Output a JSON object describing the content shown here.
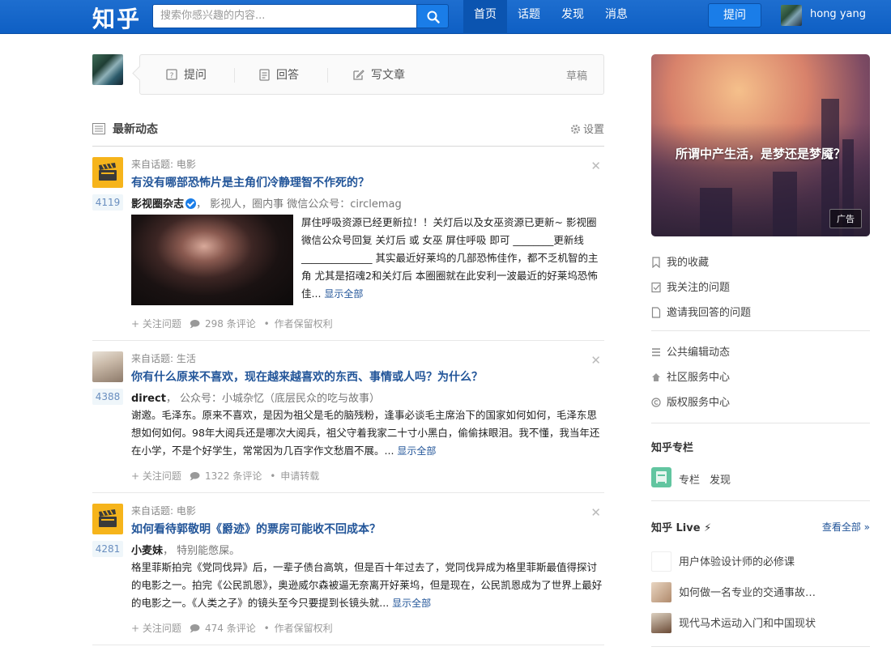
{
  "topbar": {
    "logo": "知乎",
    "search_placeholder": "搜索你感兴趣的内容...",
    "nav": [
      "首页",
      "话题",
      "发现",
      "消息"
    ],
    "ask_label": "提问",
    "user_name": "hong yang"
  },
  "composer": {
    "ask": "提问",
    "answer": "回答",
    "write": "写文章",
    "draft": "草稿"
  },
  "feed": {
    "title": "最新动态",
    "settings": "设置",
    "items": [
      {
        "source": "来自话题: 电影",
        "question": "有没有哪部恐怖片是主角们冷静理智不作死的？",
        "votes": "4119",
        "author": "影视圈杂志",
        "bio": "，  影视人，圈内事 微信公众号：circlemag",
        "excerpt": "屏住呼吸资源已经更新拉！！关灯后以及女巫资源已更新~ 影视圈微信公众号回复 关灯后 或 女巫 屏住呼吸 即可 ________更新线______________ 其实最近好莱坞的几部恐怖佳作，都不乏机智的主角 尤其是招魂2和关灯后 本圈圈就在此安利一波最近的好莱坞恐怖佳...",
        "more": "显示全部",
        "follow": "+ 关注问题",
        "comments": "298 条评论",
        "rights": "作者保留权利"
      },
      {
        "source": "来自话题: 生活",
        "question": "你有什么原来不喜欢，现在越来越喜欢的东西、事情或人吗？为什么？",
        "votes": "4388",
        "author": "direct",
        "bio": "，  公众号：小城杂忆（底层民众的吃与故事）",
        "excerpt": "谢邀。毛泽东。原来不喜欢，是因为祖父是毛的脑残粉，逢事必谈毛主席治下的国家如何如何，毛泽东思想如何如何。98年大阅兵还是哪次大阅兵，祖父守着我家二十寸小黑白，偷偷抹眼泪。我不懂，我当年还在小学，不是个好学生，常常因为几百字作文愁眉不展。...",
        "more": "显示全部",
        "follow": "+ 关注问题",
        "comments": "1322 条评论",
        "rights": "申请转载"
      },
      {
        "source": "来自话题: 电影",
        "question": "如何看待郭敬明《爵迹》的票房可能收不回成本？",
        "votes": "4281",
        "author": "小麦妹",
        "bio": "，  特别能憋屎。",
        "excerpt": "格里菲斯拍完《党同伐异》后，一辈子债台高筑，但是百十年过去了，党同伐异成为格里菲斯最值得探讨的电影之一。拍完《公民凯恩》，奥逊威尔森被逼无奈离开好莱坞，但是现在，公民凯恩成为了世界上最好的电影之一。《人类之子》的镜头至今只要提到长镜头就...",
        "more": "显示全部",
        "follow": "+ 关注问题",
        "comments": "474 条评论",
        "rights": "作者保留权利"
      }
    ]
  },
  "sidebar": {
    "ad_text": "所谓中产生活，是梦还是梦魇？",
    "ad_tag": "广告",
    "links_1": [
      "我的收藏",
      "我关注的问题",
      "邀请我回答的问题"
    ],
    "links_2": [
      "公共编辑动态",
      "社区服务中心",
      "版权服务中心"
    ],
    "column_title": "知乎专栏",
    "column_links": [
      "专栏",
      "发现"
    ],
    "live_title": "知乎 Live ⚡",
    "see_all": "查看全部 »",
    "live_items": [
      "用户体验设计师的必修课",
      "如何做一名专业的交通事故…",
      "现代马术运动入门和中国现状"
    ]
  }
}
